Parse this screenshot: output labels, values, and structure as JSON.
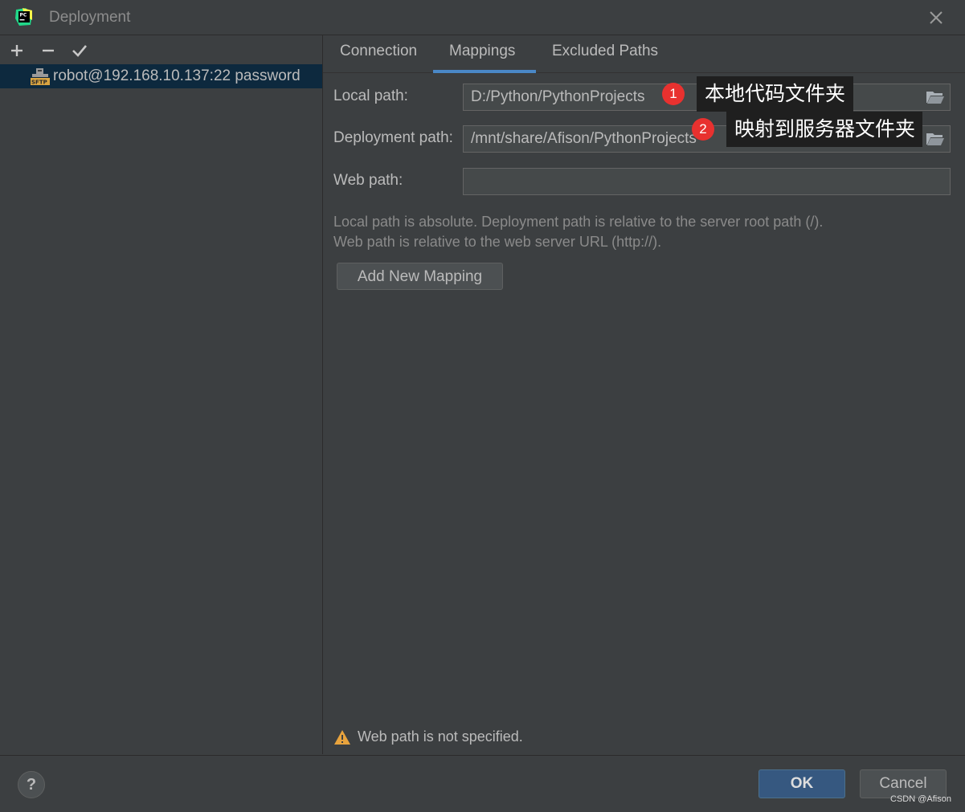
{
  "window": {
    "title": "Deployment"
  },
  "toolbar": {
    "add_icon": "plus-icon",
    "remove_icon": "minus-icon",
    "apply_icon": "check-icon"
  },
  "servers": [
    {
      "label": "robot@192.168.10.137:22 password",
      "icon": "sftp-icon"
    }
  ],
  "tabs": [
    {
      "label": "Connection",
      "active": false
    },
    {
      "label": "Mappings",
      "active": true
    },
    {
      "label": "Excluded Paths",
      "active": false
    }
  ],
  "mappings": {
    "local_path_label": "Local path:",
    "local_path_value": "D:/Python/PythonProjects",
    "deployment_path_label": "Deployment path:",
    "deployment_path_value": "/mnt/share/Afison/PythonProjects",
    "web_path_label": "Web path:",
    "web_path_value": "",
    "hint_line1": "Local path is absolute. Deployment path is relative to the server root path (/).",
    "hint_line2": "Web path is relative to the web server URL (http://).",
    "add_mapping_label": "Add New Mapping"
  },
  "warning": {
    "text": "Web path is not specified.",
    "color": "#e8a33d"
  },
  "annotations": [
    {
      "number": "1",
      "text": "本地代码文件夹"
    },
    {
      "number": "2",
      "text": "映射到服务器文件夹"
    }
  ],
  "footer": {
    "help_label": "?",
    "ok_label": "OK",
    "cancel_label": "Cancel",
    "watermark": "CSDN @Afison"
  },
  "colors": {
    "accent": "#4a88c7",
    "selection": "#0d293e",
    "badge": "#e8312f",
    "ok": "#365880"
  }
}
